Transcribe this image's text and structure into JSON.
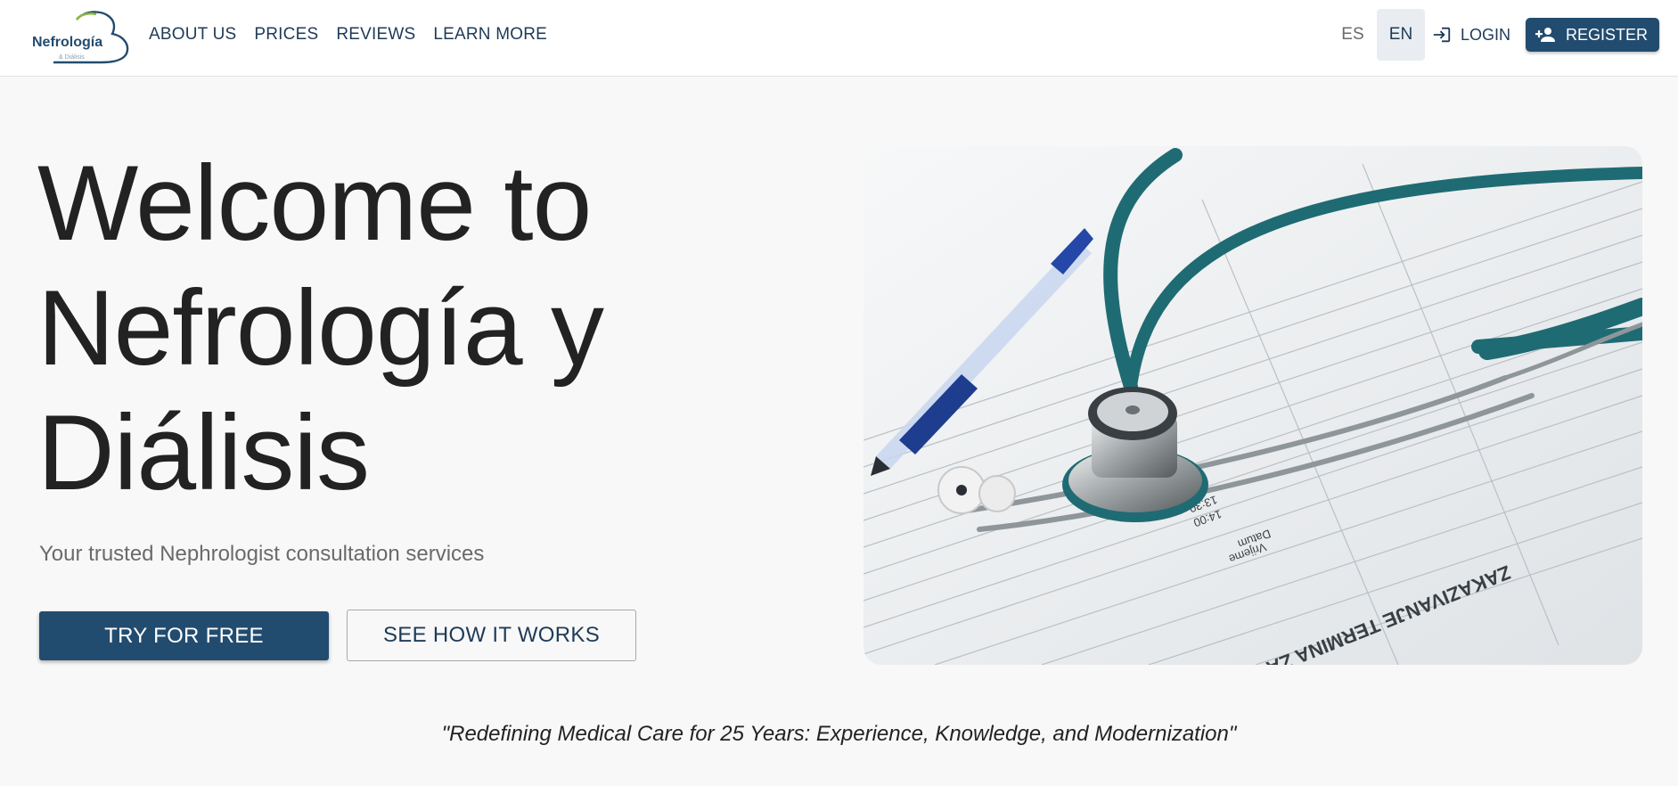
{
  "brand": {
    "logo_main": "Nefrología",
    "logo_sub": "& Diálisis"
  },
  "nav": {
    "items": [
      {
        "label": "ABOUT US"
      },
      {
        "label": "PRICES"
      },
      {
        "label": "REVIEWS"
      },
      {
        "label": "LEARN MORE"
      }
    ]
  },
  "header_tools": {
    "languages": [
      {
        "label": "ES",
        "active": false
      },
      {
        "label": "EN",
        "active": true
      }
    ],
    "login_label": "LOGIN",
    "register_label": "REGISTER",
    "login_icon": "login-icon",
    "register_icon": "person-add-icon"
  },
  "hero": {
    "title_lines": [
      "Welcome to",
      "Nefrología y",
      "Diálisis"
    ],
    "subtitle": "Your trusted Nephrologist consultation services",
    "primary_cta": "TRY FOR FREE",
    "secondary_cta": "SEE HOW IT WORKS",
    "image_text": [
      "ZAKAZIVANJE TERMINA ZA PACIJENTE",
      "13:30",
      "14:00",
      "Datum",
      "Vrijeme"
    ]
  },
  "quote": "\"Redefining Medical Care for 25 Years: Experience, Knowledge, and Modernization\"",
  "colors": {
    "primary": "#224c6f",
    "nav_text": "#1e3b58",
    "logo_green": "#8ab73f",
    "stethoscope": "#1f6b73"
  }
}
